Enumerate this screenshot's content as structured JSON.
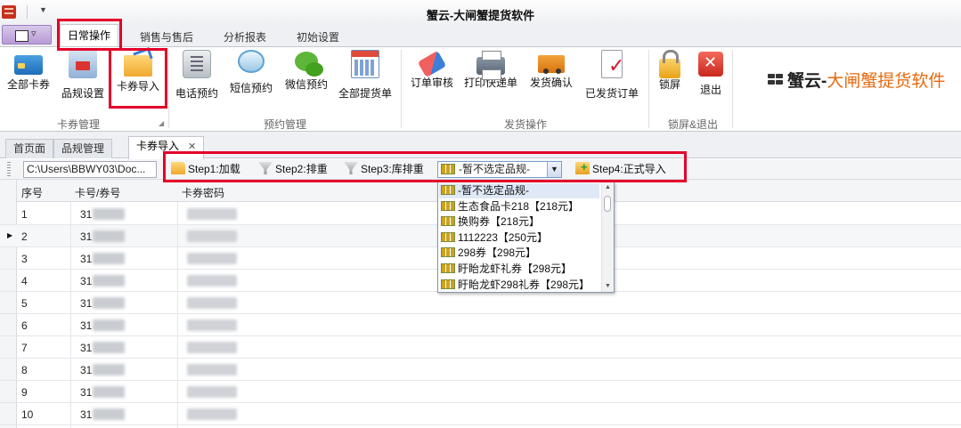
{
  "window": {
    "title": "蟹云-大闸蟹提货软件"
  },
  "ribbon_tabs": [
    "日常操作",
    "销售与售后",
    "分析报表",
    "初始设置"
  ],
  "ribbon": {
    "groups": {
      "card": {
        "label": "卡券管理",
        "buttons": {
          "all_cards": "全部卡券",
          "spec_settings": "品规设置",
          "card_import": "卡券导入"
        }
      },
      "booking": {
        "label": "预约管理",
        "buttons": {
          "phone": "电话预约",
          "sms": "短信预约",
          "wechat": "微信预约",
          "all_pickup": "全部提货单"
        }
      },
      "shipping": {
        "label": "发货操作",
        "buttons": {
          "review": "订单审核",
          "print_express": "打印快递单",
          "confirm_ship": "发货确认",
          "shipped": "已发货订单"
        }
      },
      "lock": {
        "label": "锁屏&退出",
        "buttons": {
          "lock": "锁屏",
          "exit": "退出"
        }
      }
    },
    "brand": {
      "part1": "蟹云-",
      "part2": "大闸蟹提货软件"
    }
  },
  "doc_tabs": [
    "首页面",
    "品规管理",
    "卡券导入"
  ],
  "toolbar": {
    "path": "C:\\Users\\BBWY03\\Doc...",
    "step1": "Step1:加载",
    "step2": "Step2:排重",
    "step3": "Step3:库排重",
    "selected_spec": "-暂不选定品规-",
    "step4": "Step4:正式导入"
  },
  "dropdown_options": [
    "-暂不选定品规-",
    "生态食品卡218【218元】",
    "换购券【218元】",
    "1112223【250元】",
    "298券【298元】",
    "盱眙龙虾礼券【298元】",
    "盱眙龙虾298礼券【298元】"
  ],
  "grid": {
    "headers": {
      "no": "序号",
      "card_no": "卡号/券号",
      "password": "卡券密码"
    },
    "rows": [
      {
        "no": "1",
        "card_prefix": "31"
      },
      {
        "no": "2",
        "card_prefix": "31"
      },
      {
        "no": "3",
        "card_prefix": "31"
      },
      {
        "no": "4",
        "card_prefix": "31"
      },
      {
        "no": "5",
        "card_prefix": "31"
      },
      {
        "no": "6",
        "card_prefix": "31"
      },
      {
        "no": "7",
        "card_prefix": "31"
      },
      {
        "no": "8",
        "card_prefix": "31"
      },
      {
        "no": "9",
        "card_prefix": "31"
      },
      {
        "no": "10",
        "card_prefix": "31"
      }
    ],
    "current_row": "2"
  },
  "colors": {
    "highlight": "#e3002a",
    "accent": "#e8690e"
  }
}
